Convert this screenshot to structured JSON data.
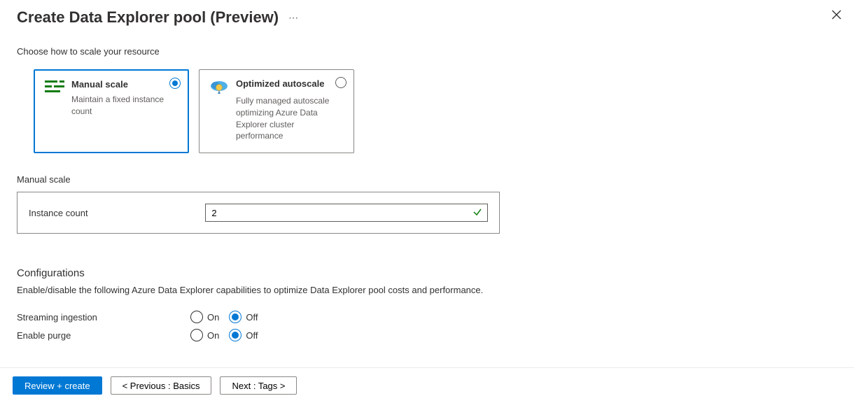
{
  "header": {
    "title": "Create Data Explorer pool (Preview)"
  },
  "scale": {
    "chooseLabel": "Choose how to scale your resource",
    "options": [
      {
        "title": "Manual scale",
        "desc": "Maintain a fixed instance count",
        "selected": true
      },
      {
        "title": "Optimized autoscale",
        "desc": "Fully managed autoscale optimizing Azure Data Explorer cluster performance",
        "selected": false
      }
    ],
    "manualLabel": "Manual scale",
    "instanceCountLabel": "Instance count",
    "instanceCountValue": "2"
  },
  "configurations": {
    "heading": "Configurations",
    "description": "Enable/disable the following Azure Data Explorer capabilities to optimize Data Explorer pool costs and performance.",
    "onLabel": "On",
    "offLabel": "Off",
    "rows": [
      {
        "label": "Streaming ingestion",
        "value": "Off"
      },
      {
        "label": "Enable purge",
        "value": "Off"
      }
    ]
  },
  "footer": {
    "review": "Review + create",
    "previous": "< Previous : Basics",
    "next": "Next : Tags >"
  }
}
